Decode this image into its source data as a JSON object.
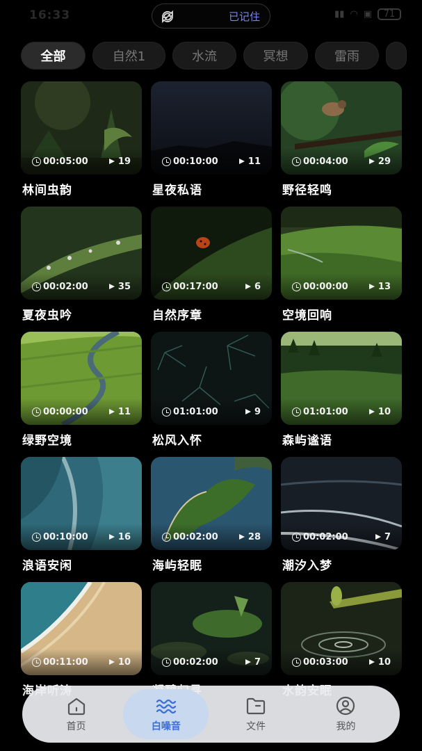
{
  "status_bar": {
    "time": "16:33",
    "island_text": "已记住",
    "battery": "71"
  },
  "chips": [
    "全部",
    "自然1",
    "水流",
    "冥想",
    "雷雨",
    ""
  ],
  "cards": [
    {
      "title": "林间虫韵",
      "duration": "00:05:00",
      "plays": "19",
      "scene": "forest-fern"
    },
    {
      "title": "星夜私语",
      "duration": "00:10:00",
      "plays": "11",
      "scene": "night-sky"
    },
    {
      "title": "野径轻鸣",
      "duration": "00:04:00",
      "plays": "29",
      "scene": "bird-branch"
    },
    {
      "title": "夏夜虫吟",
      "duration": "00:02:00",
      "plays": "35",
      "scene": "dew-leaf"
    },
    {
      "title": "自然序章",
      "duration": "00:17:00",
      "plays": "6",
      "scene": "ladybug"
    },
    {
      "title": "空境回响",
      "duration": "00:00:00",
      "plays": "13",
      "scene": "green-hills"
    },
    {
      "title": "绿野空境",
      "duration": "00:00:00",
      "plays": "11",
      "scene": "winding-river"
    },
    {
      "title": "松风入怀",
      "duration": "01:01:00",
      "plays": "9",
      "scene": "pine-needles"
    },
    {
      "title": "森屿谧语",
      "duration": "01:01:00",
      "plays": "10",
      "scene": "forest-meadow"
    },
    {
      "title": "浪语安闲",
      "duration": "00:10:00",
      "plays": "16",
      "scene": "aerial-ocean"
    },
    {
      "title": "海屿轻眠",
      "duration": "00:02:00",
      "plays": "28",
      "scene": "green-island"
    },
    {
      "title": "潮汐入梦",
      "duration": "00:02:00",
      "plays": "7",
      "scene": "dark-waves"
    },
    {
      "title": "海岸听涛",
      "duration": "00:11:00",
      "plays": "10",
      "scene": "beach-aerial"
    },
    {
      "title": "凝碧归寻",
      "duration": "00:02:00",
      "plays": "7",
      "scene": "mossy-rocks"
    },
    {
      "title": "水韵安眠",
      "duration": "00:03:00",
      "plays": "10",
      "scene": "bamboo-drop"
    }
  ],
  "nav": [
    {
      "label": "首页",
      "icon": "home-icon"
    },
    {
      "label": "白噪音",
      "icon": "waves-icon"
    },
    {
      "label": "文件",
      "icon": "folder-icon"
    },
    {
      "label": "我的",
      "icon": "profile-icon"
    }
  ],
  "colors": {
    "accent": "#3b6ed8",
    "nav_active_bg": "#c7d8ef",
    "island_text": "#7b86e8"
  }
}
